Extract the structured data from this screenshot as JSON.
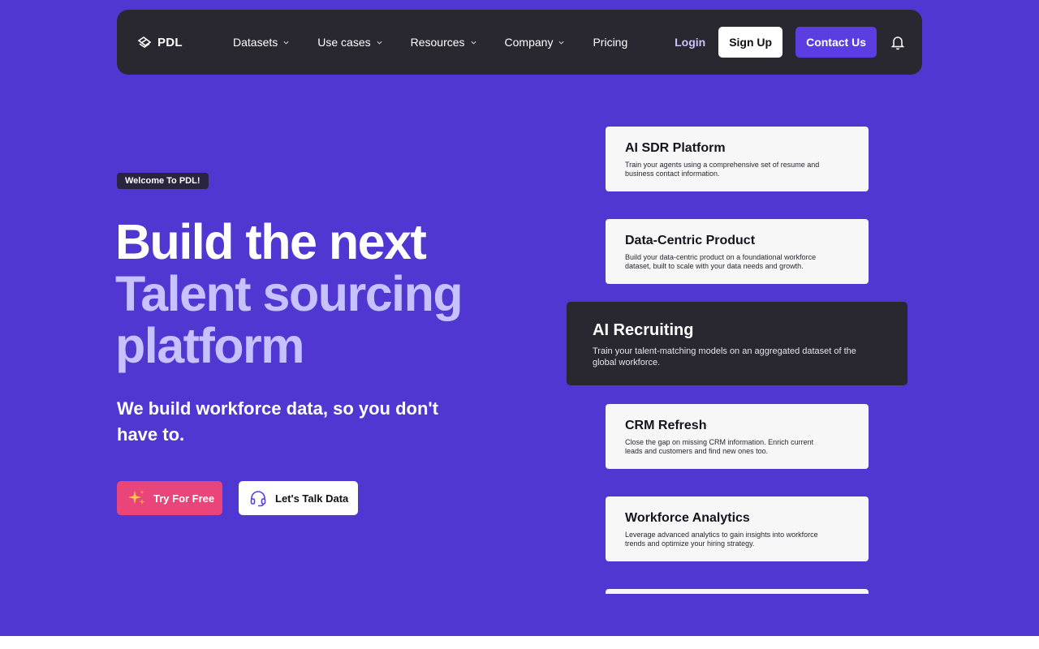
{
  "nav": {
    "logo": "PDL",
    "links": [
      {
        "label": "Datasets"
      },
      {
        "label": "Use cases"
      },
      {
        "label": "Resources"
      },
      {
        "label": "Company"
      },
      {
        "label": "Pricing"
      }
    ],
    "login": "Login",
    "signup": "Sign Up",
    "contact": "Contact Us"
  },
  "hero": {
    "badge": "Welcome To PDL!",
    "headline_line1": "Build the next",
    "headline_accent": "Talent sourcing platform",
    "subheadline": "We build workforce data, so you don't have to.",
    "try_button": "Try For Free",
    "talk_button": "Let's Talk Data"
  },
  "use_cases": [
    {
      "title": "AI SDR Platform",
      "desc": "Train your agents using a comprehensive set of resume and business contact information."
    },
    {
      "title": "Data-Centric Product",
      "desc": "Build your data-centric product on a foundational workforce dataset, built to scale with your data needs and growth."
    },
    {
      "title": "AI Recruiting",
      "desc": "Train your talent-matching models on an aggregated dataset of the global workforce."
    },
    {
      "title": "CRM Refresh",
      "desc": "Close the gap on missing CRM information. Enrich current leads and customers and find new ones too."
    },
    {
      "title": "Workforce Analytics",
      "desc": "Leverage advanced analytics to gain insights into workforce trends and optimize your hiring strategy."
    }
  ],
  "colors": {
    "hero_bg": "#5137d1",
    "nav_bg": "#29272f",
    "accent_text": "#c6c1ff",
    "primary_button": "#5b3de2",
    "try_button": "#e9457b"
  },
  "icons": {
    "logo": "pdl-logo-icon",
    "dropdown": "chevron-down-icon",
    "notifications": "bell-icon",
    "try": "sparkles-icon",
    "talk": "headset-icon"
  }
}
